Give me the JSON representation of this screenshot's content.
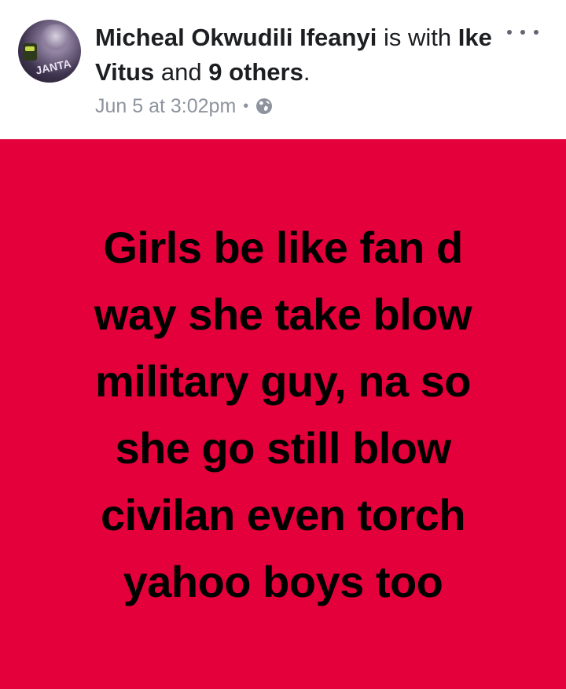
{
  "post": {
    "author": "Micheal Okwudili Ifeanyi",
    "is_with_text": "is",
    "with_text": "with",
    "tagged_friend": "Ike Vitus",
    "and_text": "and",
    "others": "9 others",
    "period": ".",
    "timestamp": "Jun 5 at 3:02pm",
    "separator": "•",
    "privacy_icon": "globe-icon",
    "more_icon": "more-options-icon",
    "avatar_text": "JANTA",
    "body_lines": [
      "Girls be like fan d",
      "way she take blow",
      "military guy, na so",
      "she go still blow",
      "civilan even torch",
      "yahoo boys too"
    ],
    "background_color": "#e4003a",
    "text_color": "#000000"
  }
}
